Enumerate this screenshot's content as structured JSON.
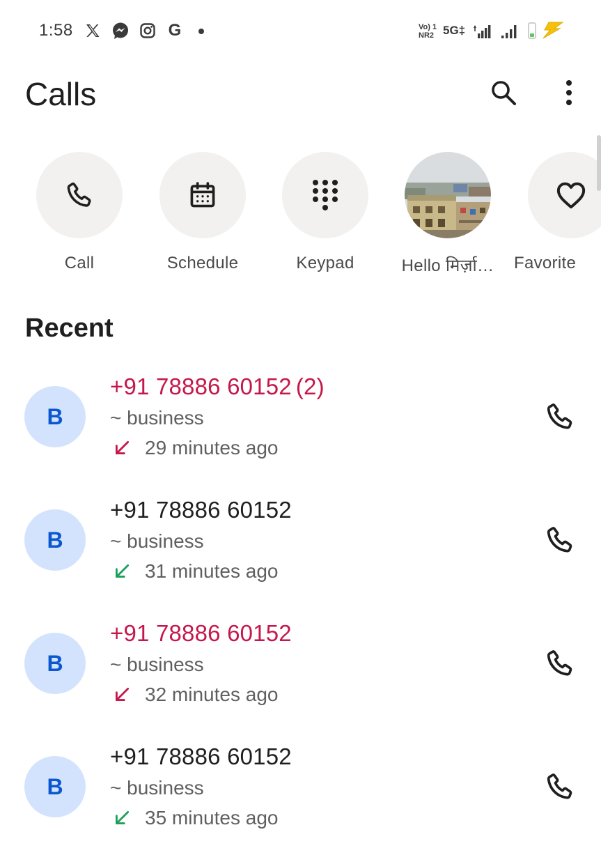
{
  "status_bar": {
    "time": "1:58",
    "notification_icons": [
      "x-icon",
      "messenger-icon",
      "instagram-icon",
      "google-icon"
    ],
    "google_glyph": "G",
    "volte_label_top": "Vo) 1",
    "volte_label_bottom": "NR2",
    "network_type": "5G‡",
    "battery_level": 0.3,
    "charging": true,
    "colors": {
      "battery_fill": "#5cc85c",
      "bolt": "#f4c20d"
    }
  },
  "header": {
    "title": "Calls",
    "search_icon": "search-icon",
    "more_icon": "more-vert-icon"
  },
  "quick_actions": [
    {
      "icon": "phone-icon",
      "label": "Call"
    },
    {
      "icon": "calendar-icon",
      "label": "Schedule"
    },
    {
      "icon": "dialpad-icon",
      "label": "Keypad"
    },
    {
      "icon": "contact-photo",
      "label": "Hello मिर्ज़ा…"
    },
    {
      "icon": "heart-icon",
      "label": "Favorite"
    }
  ],
  "recent": {
    "title": "Recent",
    "calls": [
      {
        "avatar_letter": "B",
        "number": "+91 78886 60152",
        "count": "(2)",
        "label": "~ business",
        "time": "29 minutes ago",
        "call_type": "missed",
        "call_type_icon": "call-missed-icon"
      },
      {
        "avatar_letter": "B",
        "number": "+91 78886 60152",
        "count": "",
        "label": "~ business",
        "time": "31 minutes ago",
        "call_type": "received",
        "call_type_icon": "call-received-icon"
      },
      {
        "avatar_letter": "B",
        "number": "+91 78886 60152",
        "count": "",
        "label": "~ business",
        "time": "32 minutes ago",
        "call_type": "missed",
        "call_type_icon": "call-missed-icon"
      },
      {
        "avatar_letter": "B",
        "number": "+91 78886 60152",
        "count": "",
        "label": "~ business",
        "time": "35 minutes ago",
        "call_type": "received",
        "call_type_icon": "call-received-icon"
      }
    ]
  },
  "colors": {
    "missed": "#c5174a",
    "received": "#1e9e5a",
    "avatar_bg": "#d3e3fd",
    "avatar_text": "#0b57d0",
    "action_circle_bg": "#f2f1ef"
  }
}
